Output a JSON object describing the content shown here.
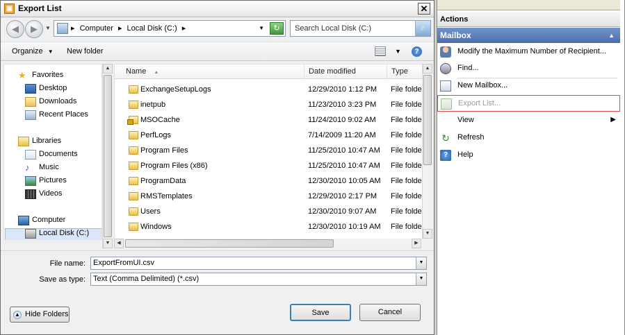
{
  "dialog": {
    "title": "Export List",
    "close_glyph": "✕",
    "address": {
      "segments": [
        "Computer",
        "Local Disk (C:)"
      ]
    },
    "search_placeholder": "Search Local Disk (C:)",
    "toolbar": {
      "organize": "Organize",
      "new_folder": "New folder"
    },
    "nav": {
      "favorites": "Favorites",
      "desktop": "Desktop",
      "downloads": "Downloads",
      "recent_places": "Recent Places",
      "libraries": "Libraries",
      "documents": "Documents",
      "music": "Music",
      "pictures": "Pictures",
      "videos": "Videos",
      "computer": "Computer",
      "local_disk": "Local Disk (C:)"
    },
    "columns": {
      "name": "Name",
      "date": "Date modified",
      "type": "Type"
    },
    "files": [
      {
        "name": "ExchangeSetupLogs",
        "date": "12/29/2010 1:12 PM",
        "type": "File folder"
      },
      {
        "name": "inetpub",
        "date": "11/23/2010 3:23 PM",
        "type": "File folder"
      },
      {
        "name": "MSOCache",
        "date": "11/24/2010 9:02 AM",
        "type": "File folder"
      },
      {
        "name": "PerfLogs",
        "date": "7/14/2009 11:20 AM",
        "type": "File folder"
      },
      {
        "name": "Program Files",
        "date": "11/25/2010 10:47 AM",
        "type": "File folder"
      },
      {
        "name": "Program Files (x86)",
        "date": "11/25/2010 10:47 AM",
        "type": "File folder"
      },
      {
        "name": "ProgramData",
        "date": "12/30/2010 10:05 AM",
        "type": "File folder"
      },
      {
        "name": "RMSTemplates",
        "date": "12/29/2010 2:17 PM",
        "type": "File folder"
      },
      {
        "name": "Users",
        "date": "12/30/2010 9:07 AM",
        "type": "File folder"
      },
      {
        "name": "Windows",
        "date": "12/30/2010 10:19 AM",
        "type": "File folder"
      }
    ],
    "file_name_label": "File name:",
    "file_name_value": "ExportFromUI.csv",
    "save_type_label": "Save as type:",
    "save_type_value": "Text (Comma Delimited) (*.csv)",
    "save_button": "Save",
    "cancel_button": "Cancel",
    "hide_folders_button": "Hide Folders"
  },
  "actions": {
    "header": "Actions",
    "section": "Mailbox",
    "items": [
      {
        "label": "Modify the Maximum Number of Recipient...",
        "icon": "user-settings-icon"
      },
      {
        "label": "Find...",
        "icon": "find-icon"
      },
      {
        "label": "New Mailbox...",
        "icon": "new-mailbox-icon"
      },
      {
        "label": "Export List...",
        "icon": "export-list-icon"
      },
      {
        "label": "View",
        "icon": "none"
      },
      {
        "label": "Refresh",
        "icon": "refresh-icon"
      },
      {
        "label": "Help",
        "icon": "help-icon"
      }
    ]
  }
}
